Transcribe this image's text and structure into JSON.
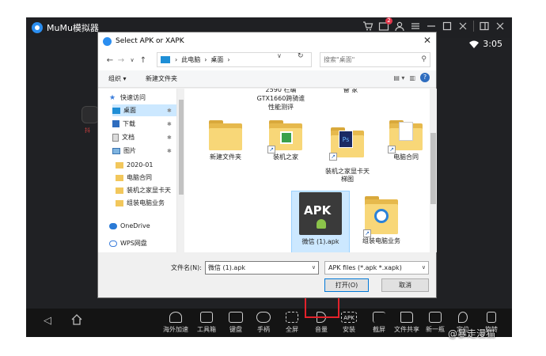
{
  "emulator": {
    "title": "MuMu模拟器",
    "badge_count": "2",
    "time": "3:05",
    "bg_app_label": "抖",
    "toolbar": [
      {
        "label": "海外加速",
        "icon": "rocket-icon"
      },
      {
        "label": "工具箱",
        "icon": "toolbox-icon"
      },
      {
        "label": "键盘",
        "icon": "keyboard-icon"
      },
      {
        "label": "手柄",
        "icon": "gamepad-icon"
      },
      {
        "label": "全屏",
        "icon": "fullscreen-icon"
      },
      {
        "label": "音量",
        "icon": "volume-icon"
      },
      {
        "label": "安装",
        "icon": "apk-install-icon",
        "icon_text": "APK"
      },
      {
        "label": "截屏",
        "icon": "crop-icon"
      },
      {
        "label": "文件共享",
        "icon": "folder-share-icon"
      },
      {
        "label": "新一瓶",
        "icon": "multi-window-icon"
      },
      {
        "label": "定位",
        "icon": "location-icon"
      },
      {
        "label": "旋转",
        "icon": "rotate-icon"
      }
    ]
  },
  "watermark": "@暴走漫猫",
  "dialog": {
    "title": "Select APK or XAPK",
    "address": {
      "path": [
        "此电脑",
        "桌面"
      ],
      "search_placeholder": "搜索\"桌面\""
    },
    "commands": {
      "organize": "组织 ▾",
      "new_folder": "新建文件夹"
    },
    "nav_items": [
      {
        "label": "快速访问",
        "icon": "star-icon",
        "pinned": false
      },
      {
        "label": "桌面",
        "icon": "desktop-icon",
        "pinned": true
      },
      {
        "label": "下载",
        "icon": "download-icon",
        "pinned": true
      },
      {
        "label": "文档",
        "icon": "document-icon",
        "pinned": true
      },
      {
        "label": "图片",
        "icon": "picture-icon",
        "pinned": true
      },
      {
        "label": "2020-01",
        "icon": "folder-icon",
        "pinned": false
      },
      {
        "label": "电脑合同",
        "icon": "folder-icon",
        "pinned": false
      },
      {
        "label": "装机之家显卡天",
        "icon": "folder-icon",
        "pinned": false
      },
      {
        "label": "组装电脑业务",
        "icon": "folder-icon",
        "pinned": false
      },
      {
        "label": "OneDrive",
        "icon": "cloud-icon",
        "pinned": false
      },
      {
        "label": "WPS网盘",
        "icon": "cloud-drive-icon",
        "pinned": false
      }
    ],
    "files_partial_top": [
      {
        "label": "2590 栏编\nGTX1660跨骑谁\n性能测评"
      },
      {
        "label": "备 家"
      }
    ],
    "files": [
      {
        "label": "新建文件夹",
        "type": "folder"
      },
      {
        "label": "装机之家",
        "type": "folder-shortcut"
      },
      {
        "label": "装机之家显卡天\n梯图",
        "type": "folder-ps"
      },
      {
        "label": "电脑合同",
        "type": "folder-shortcut"
      },
      {
        "label": "微信 (1).apk",
        "type": "apk"
      },
      {
        "label": "组装电脑业务",
        "type": "folder-ie"
      }
    ],
    "filename_label": "文件名(N):",
    "filename_value": "微信 (1).apk",
    "filetype_value": "APK files (*.apk *.xapk)",
    "open_button": "打开(O)",
    "cancel_button": "取消"
  }
}
